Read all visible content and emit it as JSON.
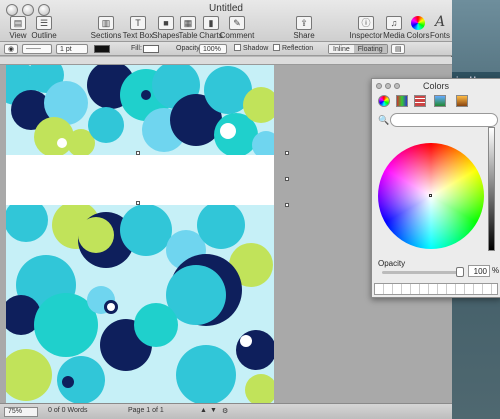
{
  "window": {
    "title": "Untitled"
  },
  "desktop": {
    "promo_text": "ire Hom"
  },
  "toolbar": {
    "view": "View",
    "outline": "Outline",
    "sections": "Sections",
    "text_box": "Text Box",
    "shapes": "Shapes",
    "table": "Table",
    "charts": "Charts",
    "comment": "Comment",
    "share": "Share",
    "inspector": "Inspector",
    "media": "Media",
    "colors": "Colors",
    "fonts": "Fonts",
    "text_box_glyph": "T",
    "fonts_glyph": "A"
  },
  "formatbar": {
    "stroke_width": "1 pt",
    "fill_label": "Fill:",
    "opacity_label": "Opacity",
    "opacity_value": "100%",
    "shadow_label": "Shadow",
    "reflection_label": "Reflection",
    "inline_label": "Inline",
    "floating_label": "Floating"
  },
  "colors_panel": {
    "title": "Colors",
    "opacity_label": "Opacity",
    "opacity_value": "100",
    "percent": "%"
  },
  "statusbar": {
    "zoom": "75%",
    "word_count": "0 of 0 Words",
    "page": "Page 1 of 1"
  },
  "colors": {
    "navy": "#0e1f5c",
    "aqua": "#31c6d8",
    "turquoise": "#1fd0cc",
    "lime": "#c1e35a",
    "sky": "#6fd5ef",
    "pale": "#c6f0f7"
  }
}
